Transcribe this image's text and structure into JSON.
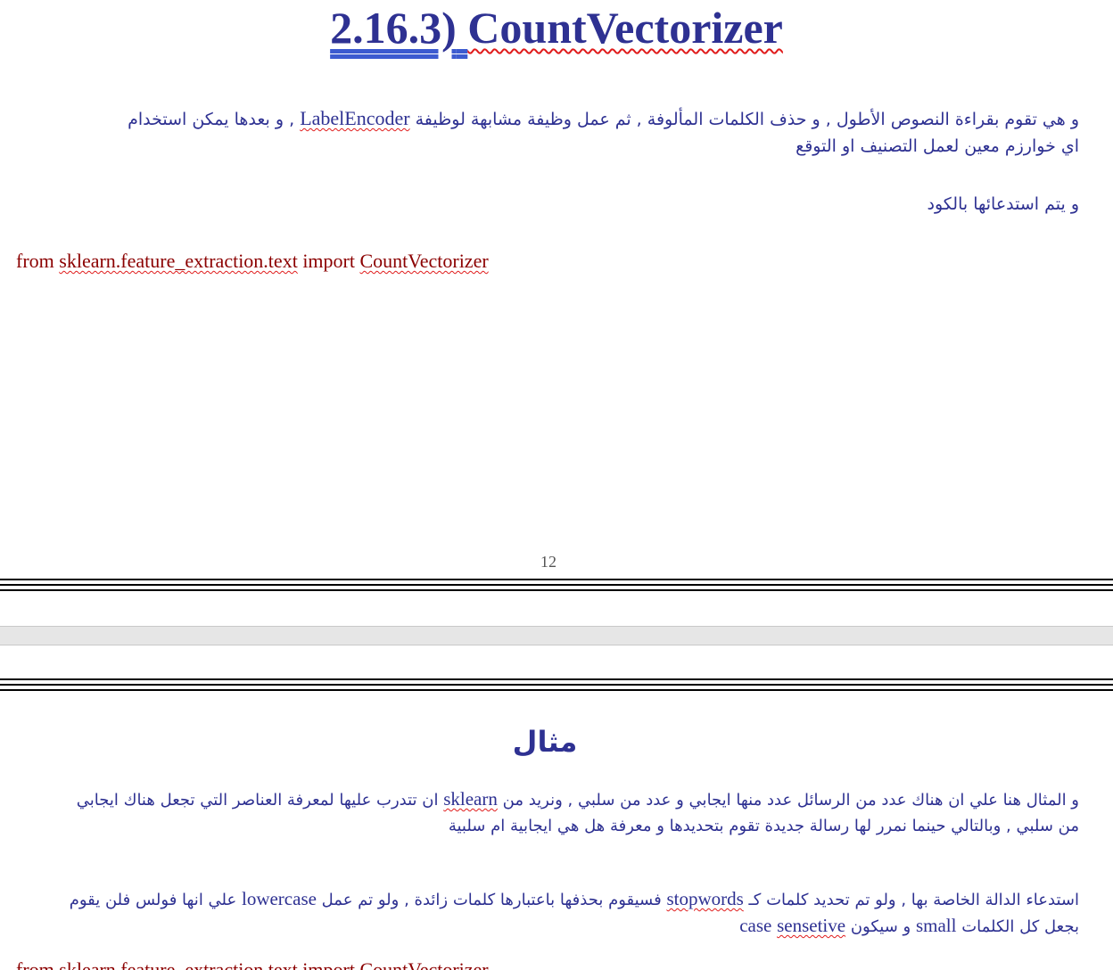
{
  "page1": {
    "title_prefix": "2.16.3)",
    "title_word": "CountVectorizer",
    "para1_line1_part1": "و هي تقوم بقراءة النصوص الأطول , و حذف الكلمات المألوفة , ثم عمل وظيفة مشابهة لوظيفة",
    "para1_line1_term": "LabelEncoder",
    "para1_line1_part2": ", و بعدها يمكن استخدام",
    "para1_line2": "اي خوارزم معين لعمل التصنيف او التوقع",
    "para2": "و يتم استدعائها بالكود",
    "code_from": "from",
    "code_module": "sklearn.feature_extraction.text",
    "code_import": "import",
    "code_class": "CountVectorizer",
    "page_number": "12"
  },
  "page2": {
    "heading": "مثال",
    "ex_line1_part1": "و المثال هنا علي ان هناك عدد من الرسائل عدد منها ايجابي و عدد من سلبي , ونريد من",
    "ex_line1_term": "sklearn",
    "ex_line1_part2": "ان تتدرب عليها لمعرفة العناصر التي تجعل هناك ايجابي",
    "ex_line2": "من سلبي , وبالتالي حينما نمرر لها رسالة جديدة تقوم بتحديدها و معرفة هل هي ايجابية ام سلبية",
    "sw_line1_part1": "استدعاء الدالة الخاصة بها , ولو تم تحديد كلمات كـ",
    "sw_line1_term1": "stopwords",
    "sw_line1_part2": "فسيقوم بحذفها باعتبارها كلمات زائدة , ولو تم عمل",
    "sw_line1_term2": "lowercase",
    "sw_line1_part3": "علي انها فولس فلن يقوم",
    "sw_line2_part1": "بجعل كل الكلمات",
    "sw_line2_term1": "small",
    "sw_line2_part2": "و سيكون",
    "sw_line2_term2": "case",
    "sw_line2_term3": "sensetive",
    "cutoff_text": "from sklearn.feature_extraction.text import CountVectorizer"
  },
  "colors": {
    "text_navy": "#2e3192",
    "code_red": "#8b0000",
    "spell_underline": "#e01b1b",
    "page_gap": "#e6e6e6"
  }
}
